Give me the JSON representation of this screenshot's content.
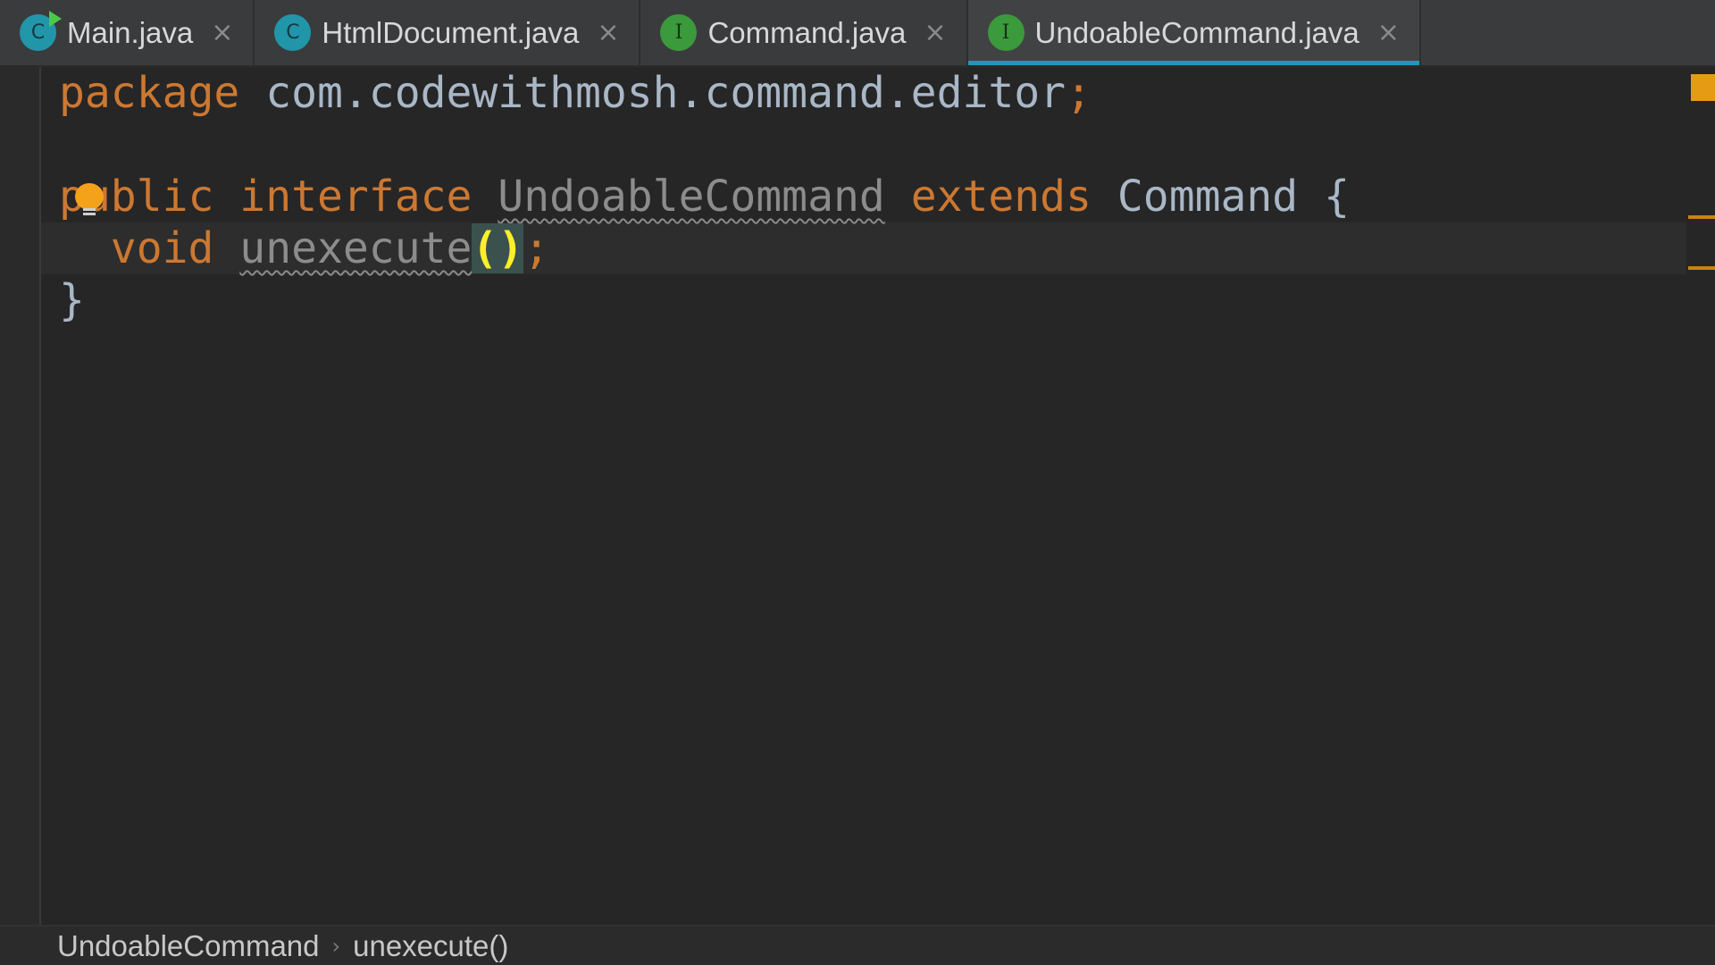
{
  "tabs": [
    {
      "label": "Main.java",
      "icon": "class-run-icon",
      "icon_glyph": "C",
      "close": "×"
    },
    {
      "label": "HtmlDocument.java",
      "icon": "class-icon",
      "icon_glyph": "C",
      "close": "×"
    },
    {
      "label": "Command.java",
      "icon": "interface-icon",
      "icon_glyph": "I",
      "close": "×"
    },
    {
      "label": "UndoableCommand.java",
      "icon": "interface-icon",
      "icon_glyph": "I",
      "close": "×",
      "active": true
    }
  ],
  "code": {
    "line1": {
      "kw": "package",
      "rest": "com.codewithmosh.command.editor",
      "semi": ";"
    },
    "line3": {
      "kw1": "public",
      "kw2": "interface",
      "name": "UndoableCommand",
      "kw3": "extends",
      "parent": "Command",
      "brace": "{"
    },
    "line4": {
      "kw": "void",
      "method": "unexecute",
      "parens": "()",
      "semi": ";"
    },
    "line5": {
      "brace": "}"
    }
  },
  "breadcrumbs": {
    "items": [
      "UndoableCommand",
      "unexecute()"
    ],
    "separator": "›"
  },
  "colors": {
    "keyword": "#cc7832",
    "identifier": "#a9b7c6",
    "active_tab_underline": "#1e9ab8",
    "bracket_match": "#ffef28",
    "warning_marker": "#e59b13"
  }
}
